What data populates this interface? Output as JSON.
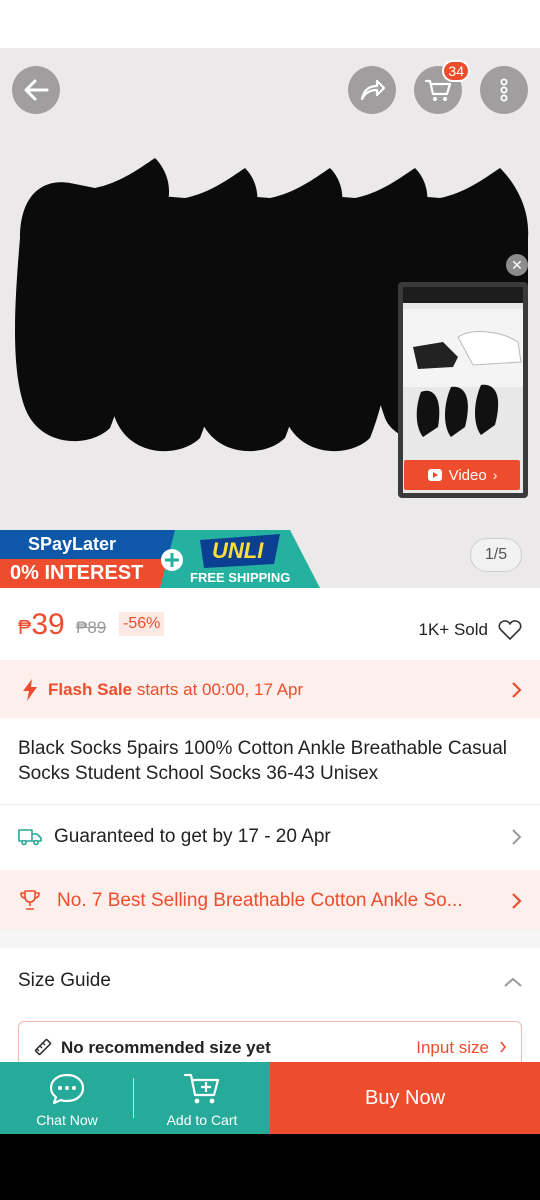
{
  "hero": {
    "cart_count": "34",
    "pip_video_label": "Video",
    "image_counter": "1/5",
    "promo": {
      "spaylater": "SPayLater",
      "interest": "0% INTEREST",
      "unli": "UNLI",
      "free_shipping": "FREE SHIPPING"
    }
  },
  "price": {
    "currency": "₱",
    "current": "39",
    "original": "₱89",
    "discount": "-56%",
    "sold": "1K+ Sold"
  },
  "flash_sale": {
    "label": "Flash Sale",
    "detail": " starts at 00:00, 17 Apr"
  },
  "product": {
    "title": "Black Socks 5pairs 100% Cotton Ankle Breathable Casual Socks Student School Socks 36-43 Unisex"
  },
  "shipping": {
    "text": "Guaranteed to get by 17 - 20 Apr"
  },
  "best_selling": {
    "text": "No. 7 Best Selling Breathable Cotton Ankle So..."
  },
  "size_guide": {
    "title": "Size Guide",
    "recommendation": "No recommended size yet",
    "input_link": "Input size"
  },
  "bottom_bar": {
    "chat_label": "Chat Now",
    "cart_label": "Add to Cart",
    "buy_label": "Buy Now"
  },
  "colors": {
    "accent": "#ee4d2d",
    "teal": "#26aa99"
  }
}
